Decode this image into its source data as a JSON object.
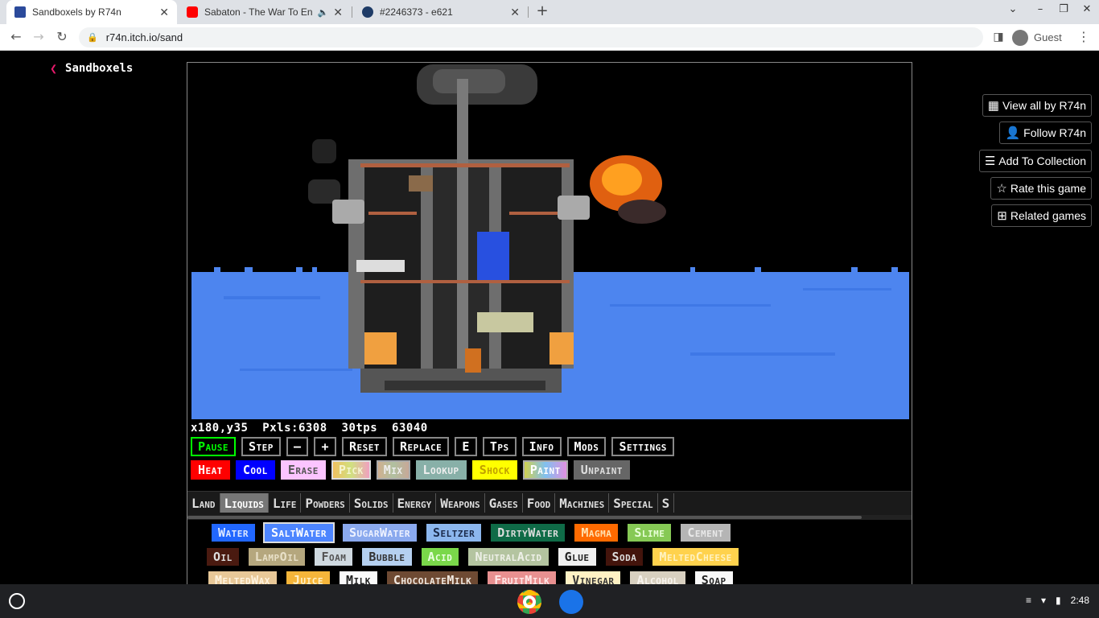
{
  "browser": {
    "tabs": [
      {
        "title": "Sandboxels by R74n",
        "favicon_color": "#2b4a9b",
        "active": true
      },
      {
        "title": "Sabaton - The War To End All Wars",
        "favicon_color": "#ff0000",
        "audio": true
      },
      {
        "title": "#2246373 - e621",
        "favicon_color": "#1f3c67"
      }
    ],
    "url": "r74n.itch.io/sand",
    "profile_label": "Guest"
  },
  "page": {
    "back_label": "Sandboxels",
    "side_buttons": [
      "View all by R74n",
      "Follow R74n",
      "Add To Collection",
      "Rate this game",
      "Related games"
    ]
  },
  "game": {
    "hud": {
      "coords": "x180,y35",
      "pixels": "Pxls:6308",
      "tps": "30tps",
      "counter": "63040"
    },
    "controls": [
      {
        "label": "Pause",
        "color": "#00ff00",
        "border": "#00ff00"
      },
      {
        "label": "Step",
        "color": "#ffffff",
        "border": "#888888"
      },
      {
        "label": "–",
        "color": "#ffffff",
        "border": "#888888"
      },
      {
        "label": "+",
        "color": "#ffffff",
        "border": "#888888"
      },
      {
        "label": "Reset",
        "color": "#ffffff",
        "border": "#888888"
      },
      {
        "label": "Replace",
        "color": "#ffffff",
        "border": "#888888"
      },
      {
        "label": "E",
        "color": "#ffffff",
        "border": "#888888"
      },
      {
        "label": "Tps",
        "color": "#ffffff",
        "border": "#888888"
      },
      {
        "label": "Info",
        "color": "#ffffff",
        "border": "#888888"
      },
      {
        "label": "Mods",
        "color": "#ffffff",
        "border": "#888888"
      },
      {
        "label": "Settings",
        "color": "#ffffff",
        "border": "#888888"
      }
    ],
    "tools": [
      {
        "label": "Heat",
        "bg": "#ff0000",
        "fg": "#ffffff"
      },
      {
        "label": "Cool",
        "bg": "#0000ff",
        "fg": "#ffffff"
      },
      {
        "label": "Erase",
        "bg": "#fbc4ff",
        "fg": "#ffffff"
      },
      {
        "label": "Pick",
        "bg": "#e8d27a",
        "fg": "#f5f5d0"
      },
      {
        "label": "Mix",
        "bg": "#c8b4a0",
        "fg": "#eeeeee"
      },
      {
        "label": "Lookup",
        "bg": "#88b0a8",
        "fg": "#eeeeee"
      },
      {
        "label": "Shock",
        "bg": "#ffff00",
        "fg": "#eeee88"
      },
      {
        "label": "Paint",
        "bg": "#d0d050",
        "fg": "#ff88ff"
      },
      {
        "label": "Unpaint",
        "bg": "#666666",
        "fg": "#dddddd"
      }
    ],
    "categories": [
      "Land",
      "Liquids",
      "Life",
      "Powders",
      "Solids",
      "Energy",
      "Weapons",
      "Gases",
      "Food",
      "Machines",
      "Special",
      "S"
    ],
    "active_category": "Liquids",
    "elements": [
      [
        {
          "label": "Water",
          "bg": "#2167ff",
          "fg": "#dde8ff"
        },
        {
          "label": "SaltWater",
          "bg": "#4d85ff",
          "fg": "#ffffff",
          "selected": true
        },
        {
          "label": "SugarWater",
          "bg": "#8aa9ee",
          "fg": "#eef2ff"
        },
        {
          "label": "Seltzer",
          "bg": "#8cb7ee",
          "fg": "#1a2a4a"
        },
        {
          "label": "DirtyWater",
          "bg": "#0f6b47",
          "fg": "#dddddd"
        },
        {
          "label": "Magma",
          "bg": "#ff6a00",
          "fg": "#ffe0b0"
        },
        {
          "label": "Slime",
          "bg": "#86c955",
          "fg": "#e8ffd8"
        },
        {
          "label": "Cement",
          "bg": "#b5b5b5",
          "fg": "#e8e8e8"
        }
      ],
      [
        {
          "label": "Oil",
          "bg": "#4a1a10",
          "fg": "#dddddd"
        },
        {
          "label": "LampOil",
          "bg": "#b5a77e",
          "fg": "#e8e0c8"
        },
        {
          "label": "Foam",
          "bg": "#cfd9e0",
          "fg": "#555555"
        },
        {
          "label": "Bubble",
          "bg": "#b5d0f0",
          "fg": "#333333"
        },
        {
          "label": "Acid",
          "bg": "#7ad84a",
          "fg": "#e8ffe0"
        },
        {
          "label": "NeutralAcid",
          "bg": "#b4c4a0",
          "fg": "#eef0e8"
        },
        {
          "label": "Glue",
          "bg": "#f0f0f0",
          "fg": "#222222"
        },
        {
          "label": "Soda",
          "bg": "#43140c",
          "fg": "#dddddd"
        },
        {
          "label": "MeltedCheese",
          "bg": "#ffd24d",
          "fg": "#fff2c0"
        }
      ],
      [
        {
          "label": "MeltedWax",
          "bg": "#e8c898",
          "fg": "#fff4e0"
        },
        {
          "label": "Juice",
          "bg": "#f5b53a",
          "fg": "#fff0c8"
        },
        {
          "label": "Milk",
          "bg": "#fafafa",
          "fg": "#222222"
        },
        {
          "label": "ChocolateMilk",
          "bg": "#6e4a33",
          "fg": "#f0e8e0"
        },
        {
          "label": "FruitMilk",
          "bg": "#e89090",
          "fg": "#ffe8e8"
        },
        {
          "label": "Vinegar",
          "bg": "#fff1c4",
          "fg": "#333333"
        },
        {
          "label": "Alcohol",
          "bg": "#d8d0c0",
          "fg": "#f8f4ee"
        },
        {
          "label": "Soap",
          "bg": "#f8f8f8",
          "fg": "#222222"
        }
      ]
    ]
  },
  "shelf": {
    "time": "2:48"
  }
}
